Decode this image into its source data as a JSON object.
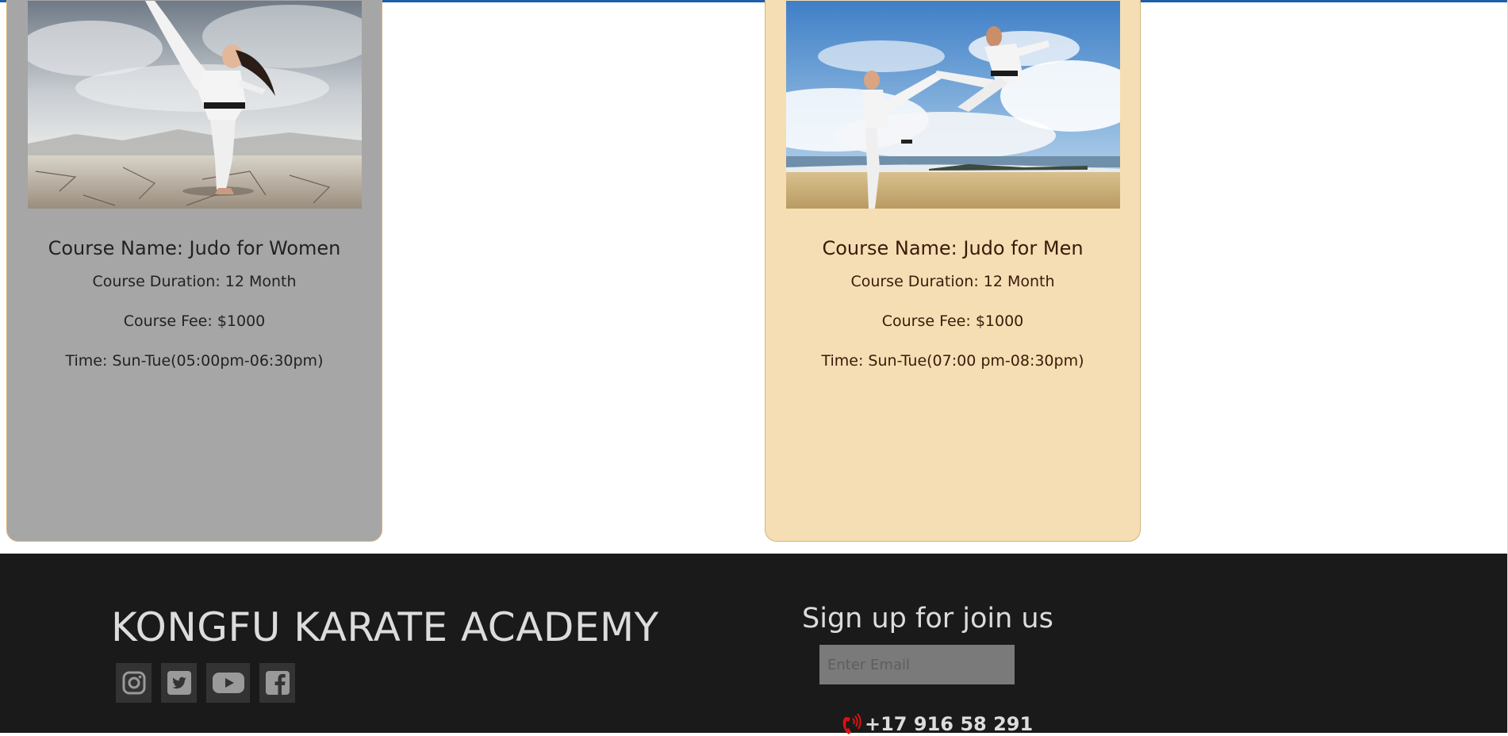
{
  "courses": [
    {
      "name": "Course Name: Judo for Women",
      "duration": "Course Duration: 12 Month",
      "fee": "Course Fee: $1000",
      "time": "Time: Sun-Tue(05:00pm-06:30pm)",
      "background": "#a6a6a6"
    },
    {
      "name": "Course Name: Judo for Men",
      "duration": "Course Duration: 12 Month",
      "fee": "Course Fee: $1000",
      "time": "Time: Sun-Tue(07:00 pm-08:30pm)",
      "background": "#f5deb3"
    }
  ],
  "footer": {
    "brand": "KONGFU KARATE ACADEMY",
    "social_icons": [
      "instagram-icon",
      "twitter-icon",
      "youtube-icon",
      "facebook-icon"
    ],
    "signup_title": "Sign up for join us",
    "email_placeholder": "Enter Email",
    "phone": "+17 916 58 291",
    "phone_icon": "phone-icon",
    "background": "#1a1a1a"
  },
  "colors": {
    "top_line": "#1f5ea8",
    "card_border": "#d6b37c",
    "footer_text": "#dcdcdc",
    "phone_icon": "#e01010"
  }
}
